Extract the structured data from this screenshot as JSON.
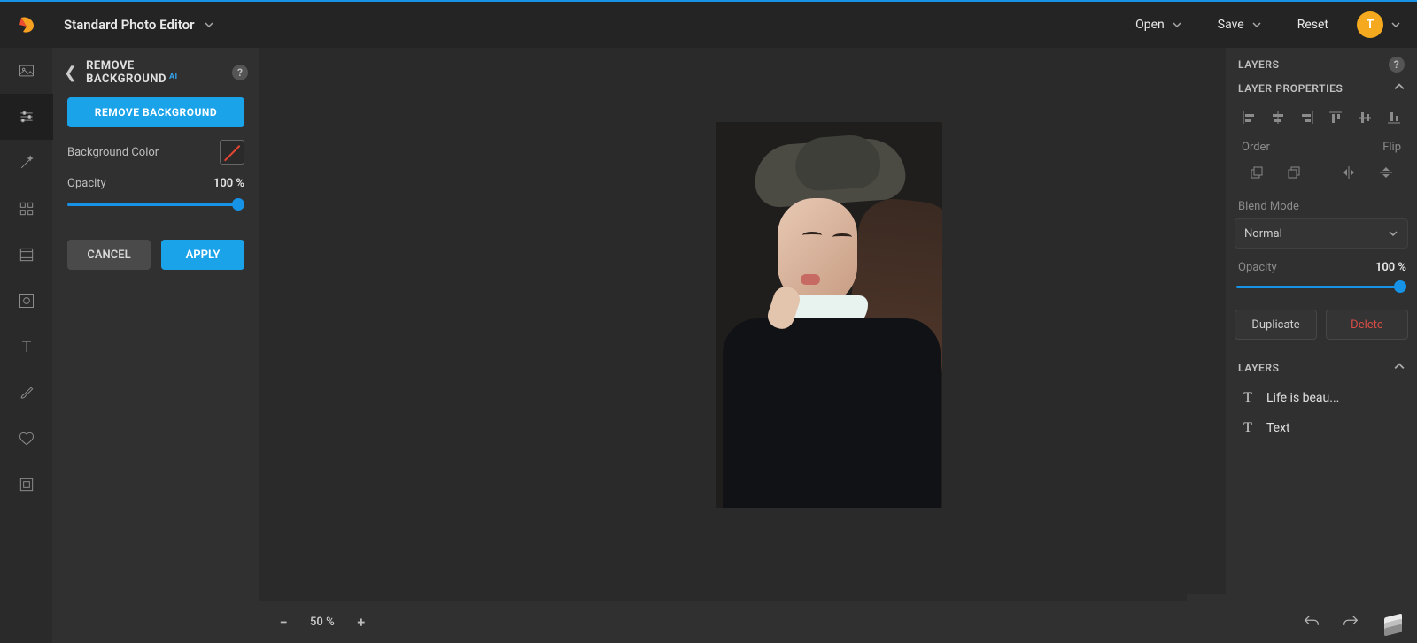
{
  "header": {
    "app_title": "Standard Photo Editor",
    "actions": {
      "open": "Open",
      "save": "Save",
      "reset": "Reset"
    },
    "avatar_letter": "T"
  },
  "options": {
    "title": "REMOVE BACKGROUND",
    "ai_tag": "AI",
    "primary_button": "REMOVE BACKGROUND",
    "bg_color_label": "Background Color",
    "opacity_label": "Opacity",
    "opacity_value": "100 %",
    "cancel": "CANCEL",
    "apply": "APPLY"
  },
  "layers_panel": {
    "title": "LAYERS",
    "properties_title": "LAYER PROPERTIES",
    "order_label": "Order",
    "flip_label": "Flip",
    "blend_label": "Blend Mode",
    "blend_value": "Normal",
    "opacity_label": "Opacity",
    "opacity_value": "100 %",
    "duplicate": "Duplicate",
    "delete": "Delete",
    "layers_section": "LAYERS",
    "items": [
      {
        "label": "Life is beau..."
      },
      {
        "label": "Text"
      }
    ]
  },
  "bottom": {
    "zoom_value": "50 %"
  }
}
